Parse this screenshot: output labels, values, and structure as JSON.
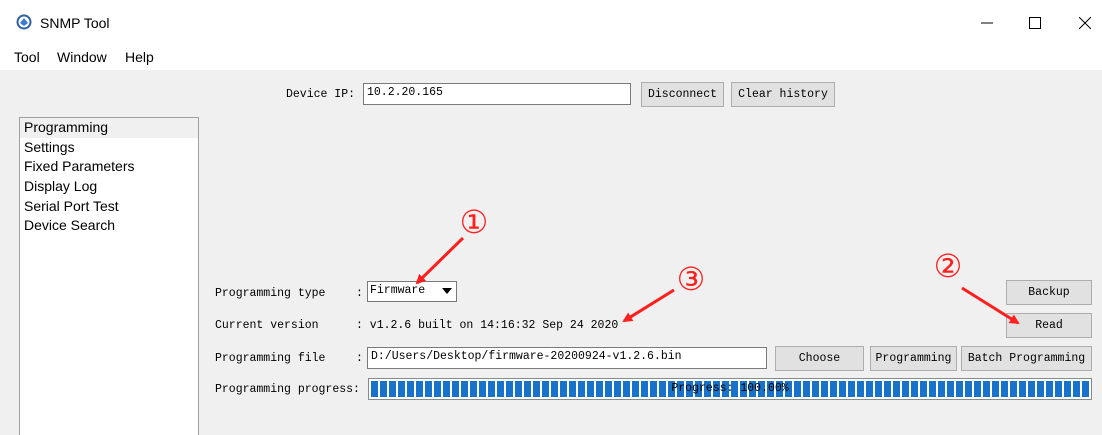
{
  "window": {
    "title": "SNMP Tool"
  },
  "menu": [
    "Tool",
    "Window",
    "Help"
  ],
  "device": {
    "ip_label": "Device IP:",
    "ip_value": "10.2.20.165",
    "disconnect_label": "Disconnect",
    "clear_history_label": "Clear history"
  },
  "sidebar": {
    "items": [
      {
        "label": "Programming",
        "selected": true
      },
      {
        "label": "Settings"
      },
      {
        "label": "Fixed Parameters"
      },
      {
        "label": "Display Log"
      },
      {
        "label": "Serial Port Test"
      },
      {
        "label": "Device Search"
      }
    ]
  },
  "form": {
    "programming_type_label": "Programming type",
    "programming_type_sep": ":",
    "programming_type_value": "Firmware",
    "current_version_label": "Current version",
    "current_version_value": ": v1.2.6 built on 14:16:32 Sep 24 2020",
    "programming_file_label": "Programming file",
    "programming_file_sep": ":",
    "programming_file_value": "D:/Users/Desktop/firmware-20200924-v1.2.6.bin",
    "progress_label": "Programming progress:",
    "progress_text": "Progress: 100.00%",
    "progress_fraction": 1.0
  },
  "buttons": {
    "backup": "Backup",
    "read": "Read",
    "choose": "Choose",
    "programming": "Programming",
    "batch_programming": "Batch Programming"
  },
  "annotations": [
    "①",
    "②",
    "③"
  ],
  "colors": {
    "annotation": "#ff1f1f",
    "progress": "#1872c9"
  }
}
